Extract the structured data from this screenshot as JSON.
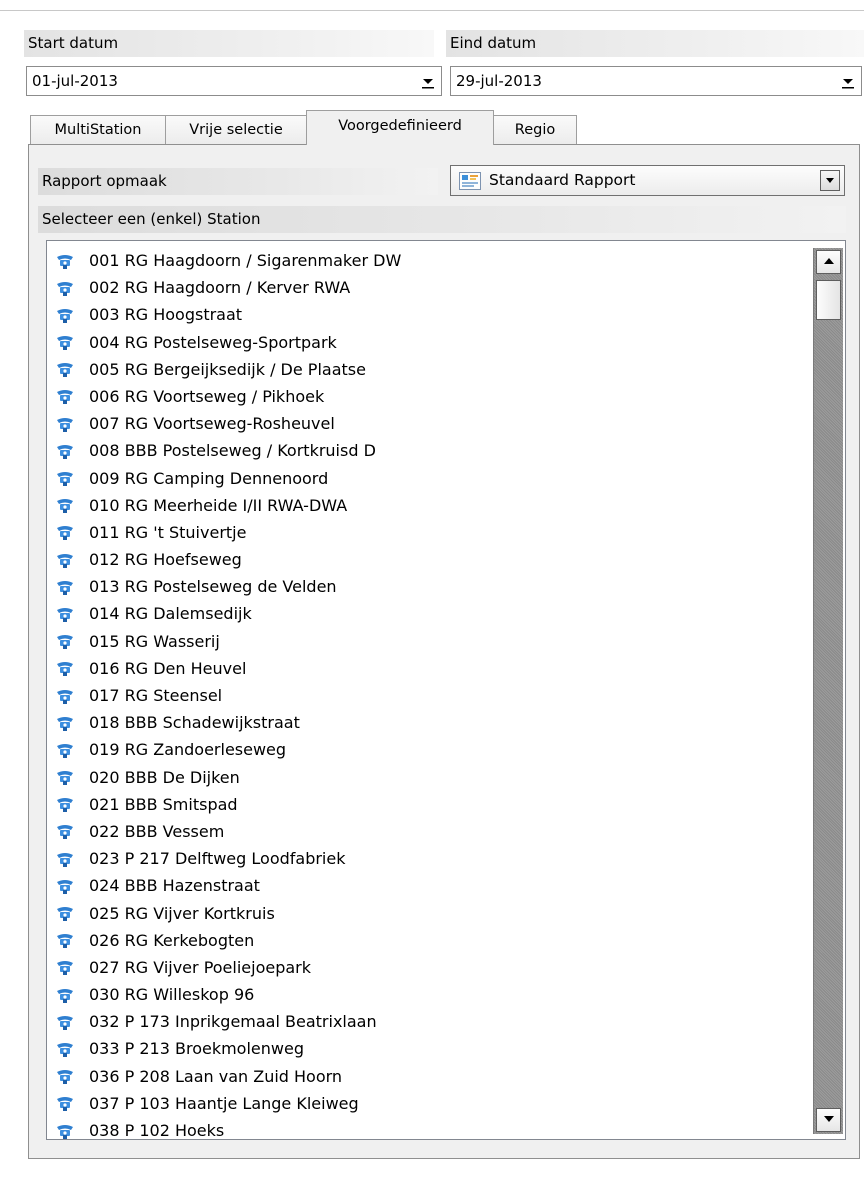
{
  "dates": {
    "start_label": "Start datum",
    "start_value": "01-jul-2013",
    "end_label": "Eind datum",
    "end_value": "29-jul-2013"
  },
  "tabs": [
    {
      "label": "MultiStation"
    },
    {
      "label": "Vrije selectie"
    },
    {
      "label": "Voorgedefinieerd"
    },
    {
      "label": "Regio"
    }
  ],
  "active_tab": "Voorgedefinieerd",
  "report": {
    "label": "Rapport opmaak",
    "value": "Standaard Rapport"
  },
  "stations": {
    "label": "Selecteer een (enkel) Station",
    "items": [
      "001 RG Haagdoorn / Sigarenmaker DW",
      "002 RG Haagdoorn / Kerver RWA",
      "003 RG Hoogstraat",
      "004 RG Postelseweg-Sportpark",
      "005 RG Bergeijksedijk / De Plaatse",
      "006 RG Voortseweg / Pikhoek",
      "007 RG Voortseweg-Rosheuvel",
      "008 BBB Postelseweg / Kortkruisd D",
      "009 RG Camping Dennenoord",
      "010 RG Meerheide I/II RWA-DWA",
      "011 RG 't Stuivertje",
      "012 RG Hoefseweg",
      "013 RG Postelseweg de Velden",
      "014 RG Dalemsedijk",
      "015 RG Wasserij",
      "016 RG Den Heuvel",
      "017 RG Steensel",
      "018 BBB Schadewijkstraat",
      "019 RG Zandoerleseweg",
      "020 BBB De Dijken",
      "021 BBB Smitspad",
      "022 BBB Vessem",
      "023 P 217 Delftweg Loodfabriek",
      "024 BBB Hazenstraat",
      "025 RG Vijver Kortkruis",
      "026 RG Kerkebogten",
      "027 RG Vijver Poeliejoepark",
      "030 RG Willeskop 96",
      "032 P 173 Inprikgemaal Beatrixlaan",
      "033 P 213 Broekmolenweg",
      "036 P 208 Laan van Zuid Hoorn",
      "037 P 103 Haantje Lange Kleiweg",
      "038 P 102 Hoeks"
    ]
  },
  "icons": {
    "station": "station-icon",
    "report": "report-icon",
    "dropdown": "chevron-down-icon"
  },
  "colors": {
    "panel_bg": "#f0f0f0",
    "station_icon": "#2f7fd0",
    "scroll_track": "#929292"
  }
}
